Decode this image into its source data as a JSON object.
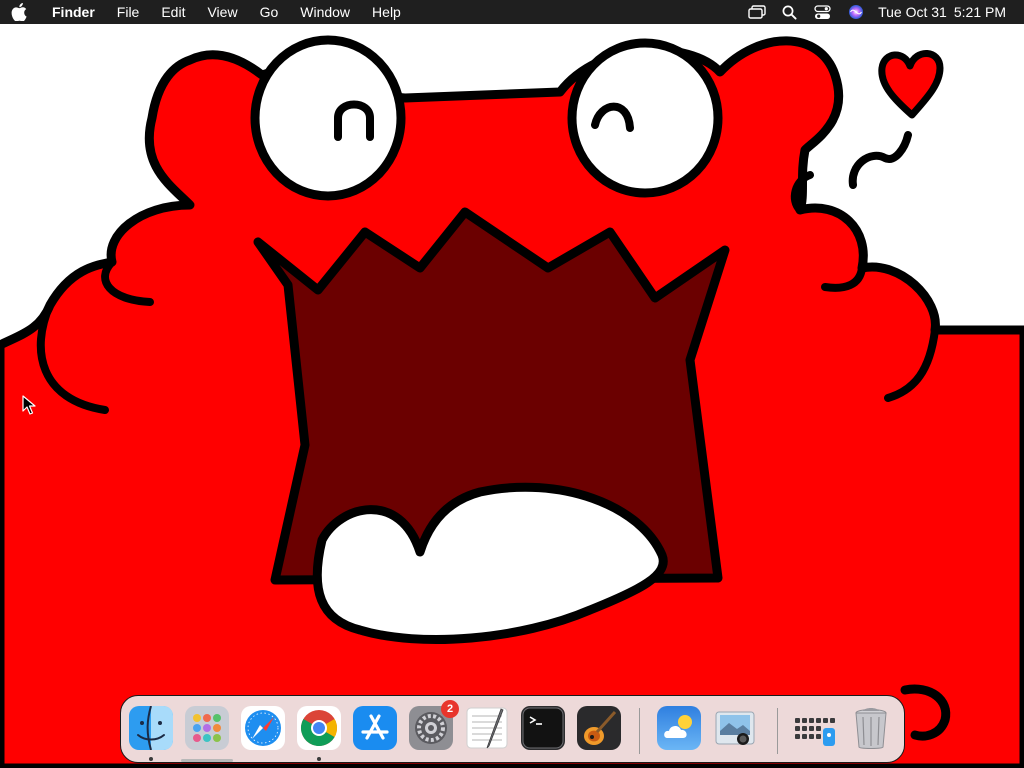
{
  "menubar": {
    "apple_icon": "apple-logo-icon",
    "app_name": "Finder",
    "items": [
      "File",
      "Edit",
      "View",
      "Go",
      "Window",
      "Help"
    ],
    "status_icons": [
      "screen-mirroring-icon",
      "search-icon",
      "control-center-icon",
      "siri-icon"
    ],
    "date": "Tue Oct 31",
    "time": "5:21 PM"
  },
  "wallpaper": {
    "subject": "red-cartoon-monster-icon",
    "colors": {
      "body": "#ff0000",
      "mouth": "#6b0000",
      "outline": "#000000",
      "eyes": "#ffffff",
      "heart": "#ff0000"
    }
  },
  "dock": {
    "apps": [
      {
        "name": "Finder",
        "icon": "finder-icon",
        "running": true
      },
      {
        "name": "Launchpad",
        "icon": "launchpad-icon",
        "running": false
      },
      {
        "name": "Safari",
        "icon": "safari-icon",
        "running": false
      },
      {
        "name": "Google Chrome",
        "icon": "chrome-icon",
        "running": true
      },
      {
        "name": "App Store",
        "icon": "app-store-icon",
        "running": false
      },
      {
        "name": "System Settings",
        "icon": "settings-gear-icon",
        "running": false,
        "badge": "2"
      },
      {
        "name": "TextEdit",
        "icon": "textedit-icon",
        "running": false
      },
      {
        "name": "Terminal",
        "icon": "terminal-icon",
        "running": false
      },
      {
        "name": "GarageBand",
        "icon": "garageband-guitar-icon",
        "running": false
      },
      {
        "name": "Weather",
        "icon": "weather-icon",
        "running": false
      },
      {
        "name": "Preview",
        "icon": "preview-icon",
        "running": false
      },
      {
        "name": "Applications",
        "icon": "applications-folder-icon",
        "running": false
      },
      {
        "name": "Trash",
        "icon": "trash-icon",
        "running": false
      }
    ]
  }
}
